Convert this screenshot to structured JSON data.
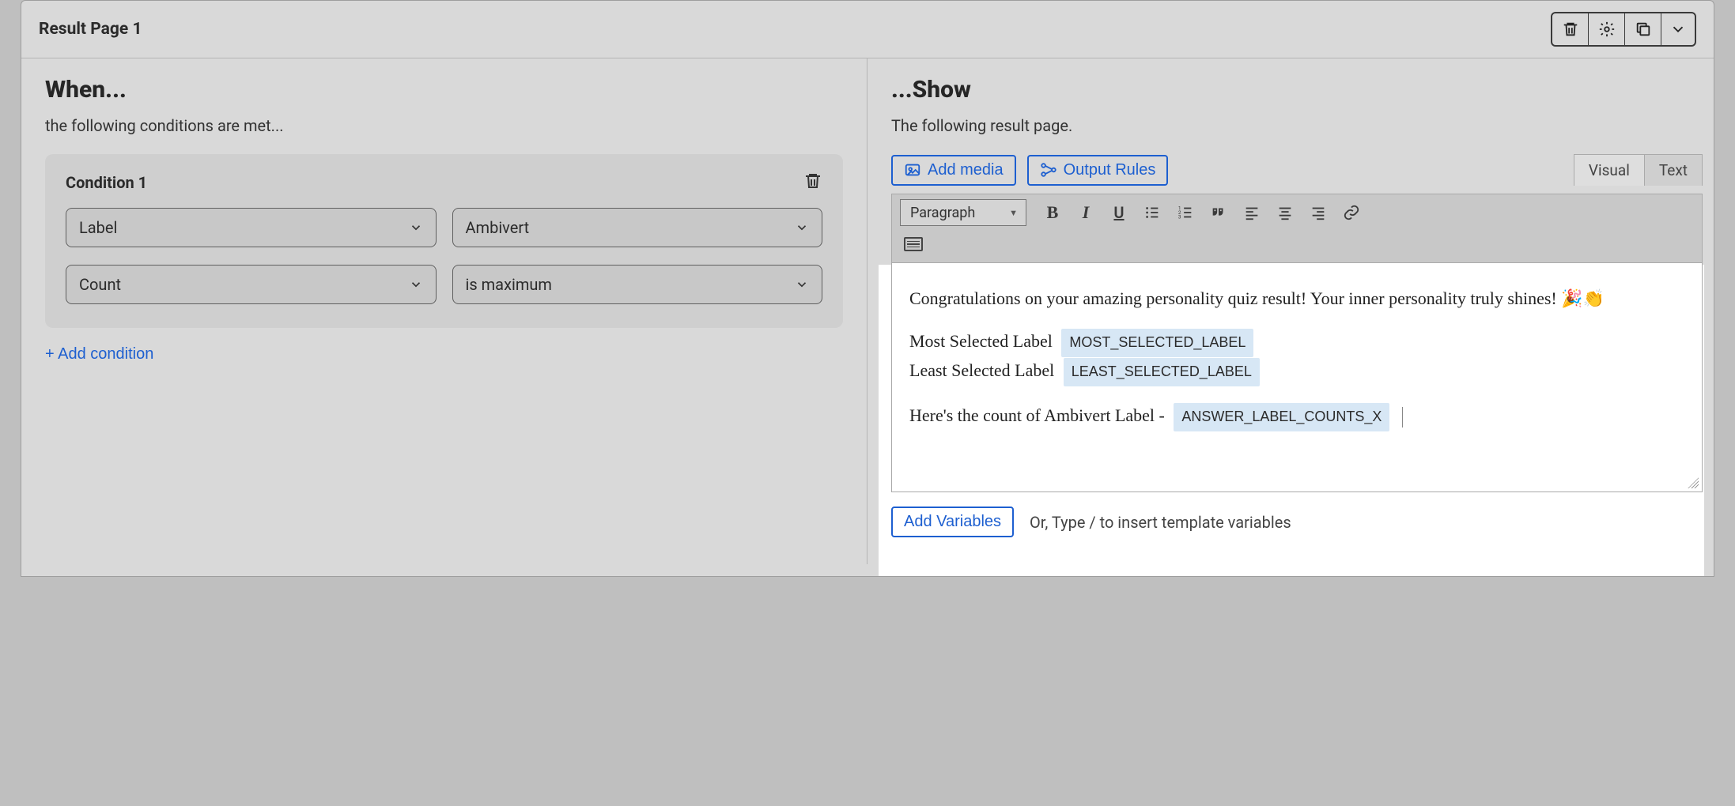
{
  "header": {
    "title": "Result Page 1"
  },
  "left": {
    "heading": "When...",
    "subtitle": "the following conditions are met...",
    "condition": {
      "title": "Condition 1",
      "row1_field": "Label",
      "row1_value": "Ambivert",
      "row2_field": "Count",
      "row2_value": "is maximum"
    },
    "add_condition": "+ Add condition"
  },
  "right": {
    "heading": "...Show",
    "subtitle": "The following result page.",
    "add_media": "Add media",
    "output_rules": "Output Rules",
    "tab_visual": "Visual",
    "tab_text": "Text",
    "format_select": "Paragraph",
    "editor": {
      "line1": "Congratulations on your amazing personality quiz result! Your inner personality truly shines! 🎉👏",
      "most_label": "Most Selected Label",
      "most_chip": "MOST_SELECTED_LABEL",
      "least_label": "Least Selected Label",
      "least_chip": "LEAST_SELECTED_LABEL",
      "count_line_prefix": "Here's the count of Ambivert Label - ",
      "count_chip": "ANSWER_LABEL_COUNTS_X"
    },
    "add_variables": "Add Variables",
    "hint": "Or, Type / to insert template variables"
  }
}
